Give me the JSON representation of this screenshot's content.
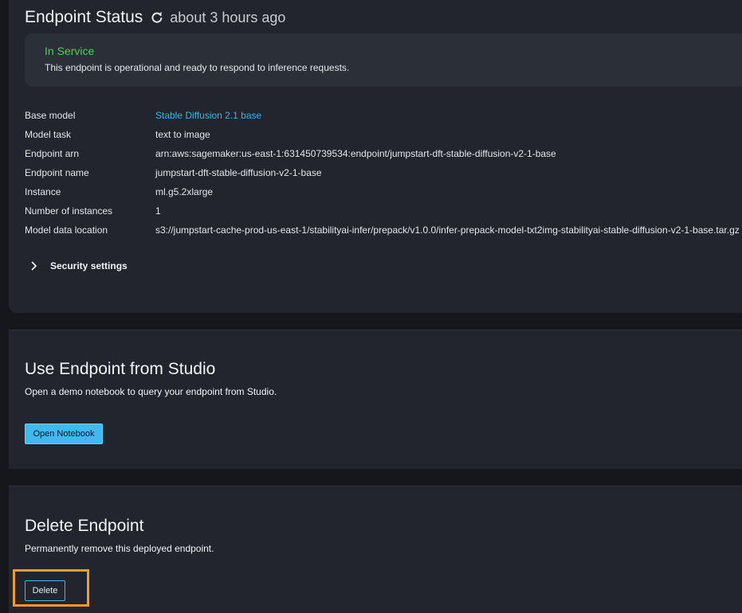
{
  "endpoint_status": {
    "title": "Endpoint Status",
    "refresh_icon": "refresh-icon",
    "updated": "about 3 hours ago",
    "state": "In Service",
    "state_color": "#44d35a",
    "description": "This endpoint is operational and ready to respond to inference requests."
  },
  "details": [
    {
      "label": "Base model",
      "value": "Stable Diffusion 2.1 base",
      "link": true
    },
    {
      "label": "Model task",
      "value": "text to image",
      "link": false
    },
    {
      "label": "Endpoint arn",
      "value": "arn:aws:sagemaker:us-east-1:631450739534:endpoint/jumpstart-dft-stable-diffusion-v2-1-base",
      "link": false
    },
    {
      "label": "Endpoint name",
      "value": "jumpstart-dft-stable-diffusion-v2-1-base",
      "link": false
    },
    {
      "label": "Instance",
      "value": "ml.g5.2xlarge",
      "link": false
    },
    {
      "label": "Number of instances",
      "value": "1",
      "link": false
    },
    {
      "label": "Model data location",
      "value": "s3://jumpstart-cache-prod-us-east-1/stabilityai-infer/prepack/v1.0.0/infer-prepack-model-txt2img-stabilityai-stable-diffusion-v2-1-base.tar.gz",
      "link": false
    }
  ],
  "security_settings": {
    "icon": "chevron-right-icon",
    "label": "Security settings"
  },
  "studio": {
    "title": "Use Endpoint from Studio",
    "description": "Open a demo notebook to query your endpoint from Studio.",
    "button_label": "Open Notebook"
  },
  "delete": {
    "title": "Delete Endpoint",
    "description": "Permanently remove this deployed endpoint.",
    "button_label": "Delete",
    "highlight_color": "#f39a2b"
  },
  "colors": {
    "background": "#15171c",
    "panel": "#22252e",
    "accent": "#3fb9ee",
    "link": "#33b8e8"
  }
}
